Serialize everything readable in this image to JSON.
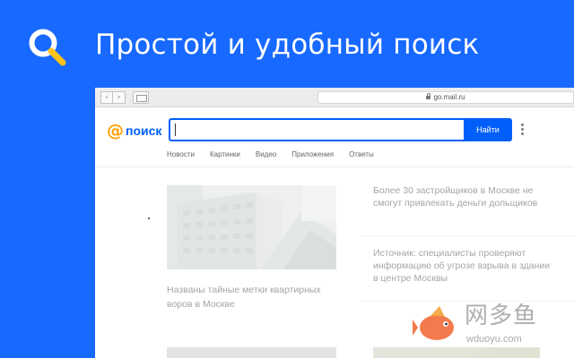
{
  "hero": {
    "title": "Простой и удобный поиск",
    "icon": "search-magnifier-icon",
    "background_color": "#1769ff"
  },
  "browser": {
    "nav_back": "‹",
    "nav_forward": "›",
    "address": "go.mail.ru"
  },
  "search": {
    "logo_at": "@",
    "logo_text": "поиск",
    "input_value": "",
    "button_label": "Найти",
    "accent_color": "#005ff9",
    "logo_accent_color": "#ff9e00"
  },
  "tabs": [
    {
      "label": "Новости"
    },
    {
      "label": "Картинки"
    },
    {
      "label": "Видео"
    },
    {
      "label": "Приложения"
    },
    {
      "label": "Ответы"
    }
  ],
  "news": {
    "left_title": "Названы тайные метки квартирных воров в Москве",
    "right": [
      {
        "title": "Более 30 застройщиков в Москве не смогут привлекать деньги дольщиков"
      },
      {
        "title": "Источник: специалисты проверяют информацию об угрозе взрыва в здании в центре Москвы"
      }
    ]
  },
  "watermark": {
    "brand": "网多鱼",
    "url": "wduoyu.com"
  }
}
